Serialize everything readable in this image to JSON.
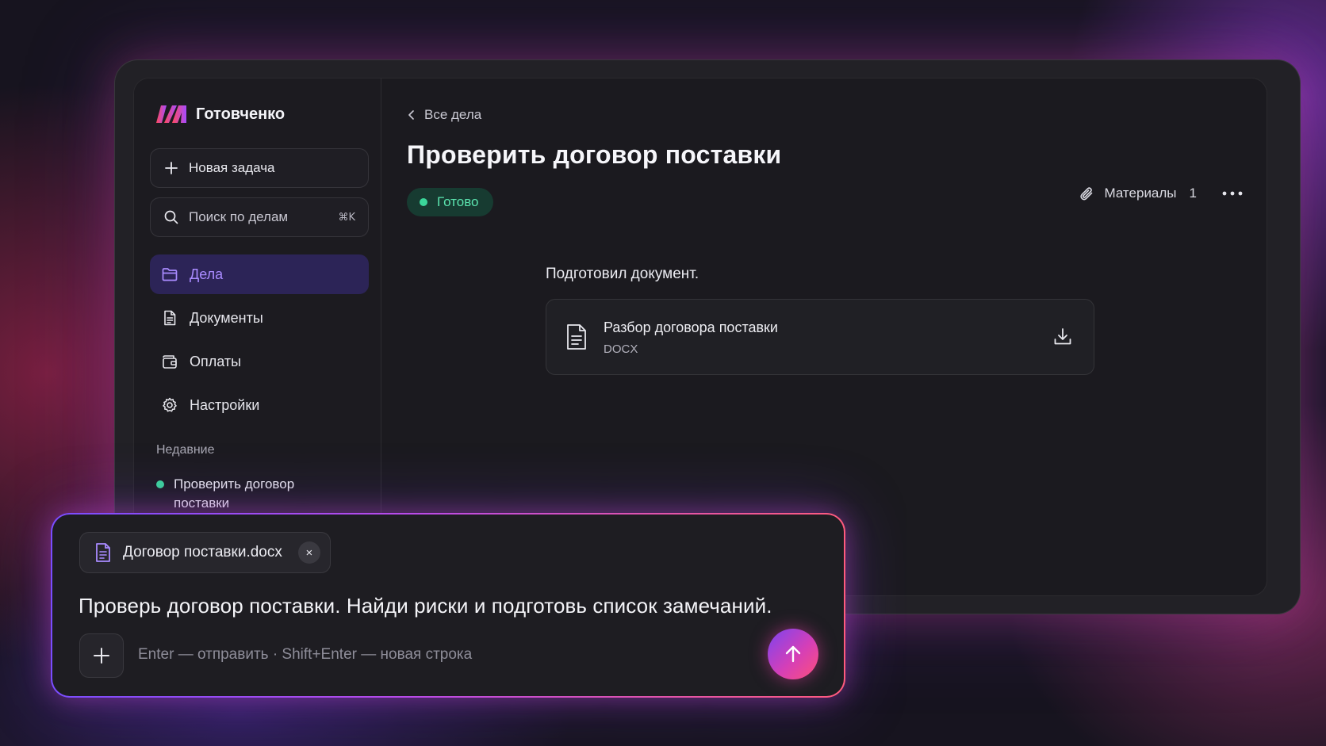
{
  "app": {
    "name": "Готовченко",
    "logo_icon": "brand-logo-icon"
  },
  "colors": {
    "accent_purple": "#A98BFF",
    "active_bg": "#2C2457",
    "status_green": "#3BD69A",
    "gradient_start": "#7A4DFF",
    "gradient_end": "#FF5B7E"
  },
  "sidebar": {
    "new_task_label": "Новая задача",
    "search": {
      "placeholder": "Поиск по делам",
      "shortcut": "⌘K"
    },
    "items": [
      {
        "label": "Дела",
        "icon": "folder-icon",
        "active": true
      },
      {
        "label": "Документы",
        "icon": "document-icon",
        "active": false
      },
      {
        "label": "Оплаты",
        "icon": "wallet-icon",
        "active": false
      },
      {
        "label": "Настройки",
        "icon": "gear-icon",
        "active": false
      }
    ],
    "recent": {
      "title": "Недавние",
      "items": [
        {
          "label": "Проверить договор поставки",
          "status": "done"
        }
      ]
    }
  },
  "task": {
    "back_label": "Все дела",
    "title": "Проверить договор поставки",
    "status": "Готово",
    "materials_label": "Материалы",
    "materials_count": "1",
    "message": "Подготовил документ.",
    "file": {
      "name": "Разбор договора поставки",
      "ext": "DOCX"
    }
  },
  "composer": {
    "attachment_name": "Договор поставки.docx",
    "attachment_close": "×",
    "prompt": "Проверь договор поставки. Найди риски и подготовь список замечаний.",
    "hint": "Enter — отправить · Shift+Enter — новая строка"
  }
}
